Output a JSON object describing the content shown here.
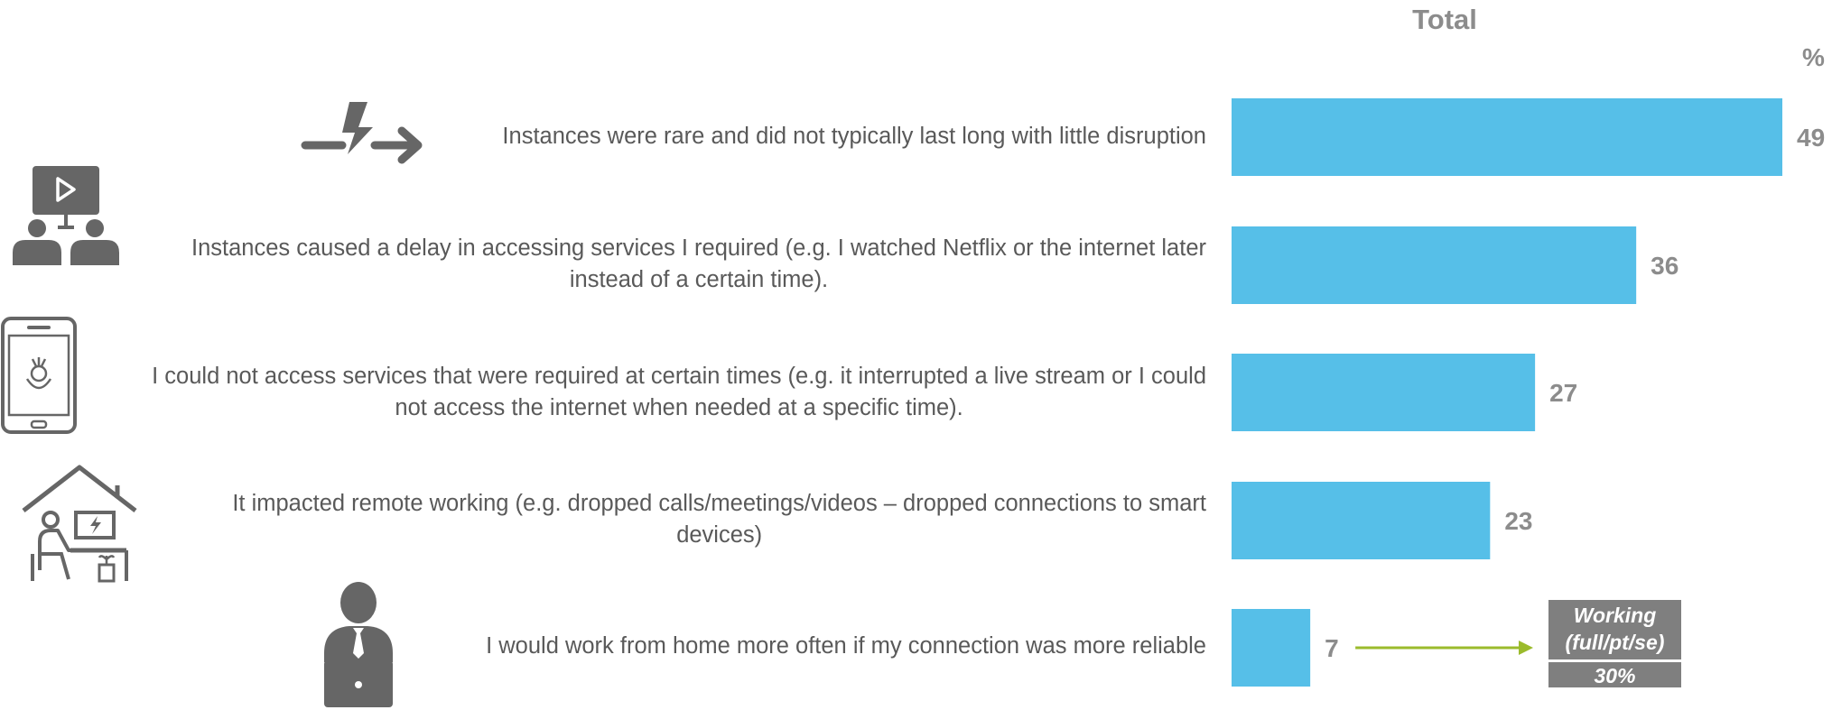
{
  "chart_data": {
    "type": "bar",
    "orientation": "horizontal",
    "title": "Total",
    "unit": "%",
    "categories": [
      "Instances were rare and did not typically last long with little disruption",
      "Instances caused a delay in accessing services I required (e.g. I watched Netflix or the internet later instead of a certain time).",
      "I could not access services that were required at certain times (e.g. it interrupted a live stream or I could not access the internet when needed at a specific time).",
      "It impacted remote working (e.g. dropped calls/meetings/videos – dropped connections to smart devices)",
      "I would work from home more often if my connection was more reliable"
    ],
    "values": [
      49,
      36,
      27,
      23,
      7
    ],
    "xlim": [
      0,
      49
    ],
    "bar_color": "#56bfe8",
    "value_label_color": "#8c8c8c",
    "grid": false
  },
  "labels": [
    [
      "Instances were rare and did not typically last long with little disruption"
    ],
    [
      "Instances caused a delay in accessing services I required (e.g. I watched Netflix or the internet later",
      "instead of a certain time)."
    ],
    [
      "I could not access services that were required at certain times (e.g. it interrupted a live stream or I could",
      "not access the internet when needed at a specific time)."
    ],
    [
      "It impacted remote working (e.g. dropped calls/meetings/videos – dropped connections to smart",
      "devices)"
    ],
    [
      "I would work from home more often if my connection was more reliable"
    ]
  ],
  "icons": [
    "power-disruption-icon",
    "video-watch-icon",
    "smartphone-icon",
    "home-office-icon",
    "laptop-worker-icon"
  ],
  "callout": {
    "line1": "Working",
    "line2": "(full/pt/se)",
    "value": "30%",
    "arrow_color": "#9bbb2c",
    "box_color": "#7f7f7f"
  }
}
